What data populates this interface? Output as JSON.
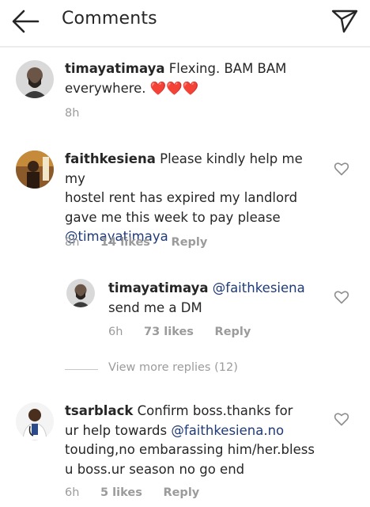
{
  "header": {
    "title": "Comments",
    "back_icon": "arrow-left-icon",
    "send_icon": "paper-plane-icon"
  },
  "caption": {
    "username": "timayatimaya",
    "text_line1": "Flexing. BAM BAM",
    "text_line2": "everywhere.",
    "hearts": "❤️❤️❤️",
    "time": "8h"
  },
  "comments": [
    {
      "username": "faithkesiena",
      "line1": "Please kindly help me my",
      "line2": "hostel rent has expired my landlord",
      "line3": "gave me this week to pay please",
      "mention": "@timayatimaya",
      "time": "8h",
      "likes": "14 likes",
      "reply": "Reply"
    },
    {
      "username": "timayatimaya",
      "mention": "@faithkesiena",
      "line2": "send me a DM",
      "time": "6h",
      "likes": "73 likes",
      "reply": "Reply"
    },
    {
      "username": "tsarblack",
      "line1": "Confirm boss.thanks for",
      "line2_prefix": "ur help towards",
      "mention": "@faithkesiena.no",
      "line3": "touding,no embarassing him/her.bless",
      "line4": "u boss.ur season no go end",
      "time": "6h",
      "likes": "5 likes",
      "reply": "Reply"
    }
  ],
  "view_more": "View more replies (12)",
  "colors": {
    "mention": "#1f3a78",
    "meta": "#9b9b9b",
    "heart": "#e0162b"
  }
}
